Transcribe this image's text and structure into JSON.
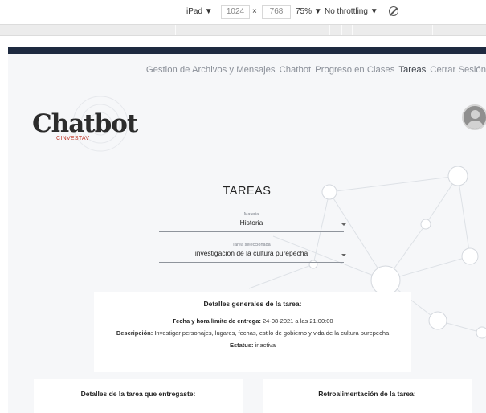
{
  "devtools": {
    "device": "iPad ▼",
    "width": "1024",
    "times": "×",
    "height": "768",
    "zoom": "75% ▼",
    "throttling": "No throttling ▼"
  },
  "nav": {
    "items": [
      "Gestion de Archivos y Mensajes",
      "Chatbot",
      "Progreso en Clases",
      "Tareas",
      "Cerrar Sesión"
    ],
    "active": "Tareas"
  },
  "logo": {
    "main": "Chatbot",
    "sub": "CINVESTAV"
  },
  "page": {
    "title": "TAREAS"
  },
  "materia": {
    "label": "Materia",
    "value": "Historia"
  },
  "tarea": {
    "label": "Tarea seleccionada",
    "value": "investigacion de la cultura purepecha"
  },
  "details": {
    "heading": "Detalles generales de la tarea:",
    "due_label": "Fecha y hora límite de entrega:",
    "due_value": " 24-08-2021 a las 21:00:00",
    "desc_label": "Descripción:",
    "desc_value": " Investigar personajes, lugares, fechas, estilo de gobierno y vida de la cultura purepecha",
    "status_label": "Estatus:",
    "status_value": " inactiva"
  },
  "delivered": {
    "heading": "Detalles de la tarea que entregaste:"
  },
  "feedback": {
    "heading": "Retroalimentación de la tarea:"
  },
  "colors": {
    "nav_stripe": "#1e2a40",
    "logo_sub": "#c0392b"
  }
}
